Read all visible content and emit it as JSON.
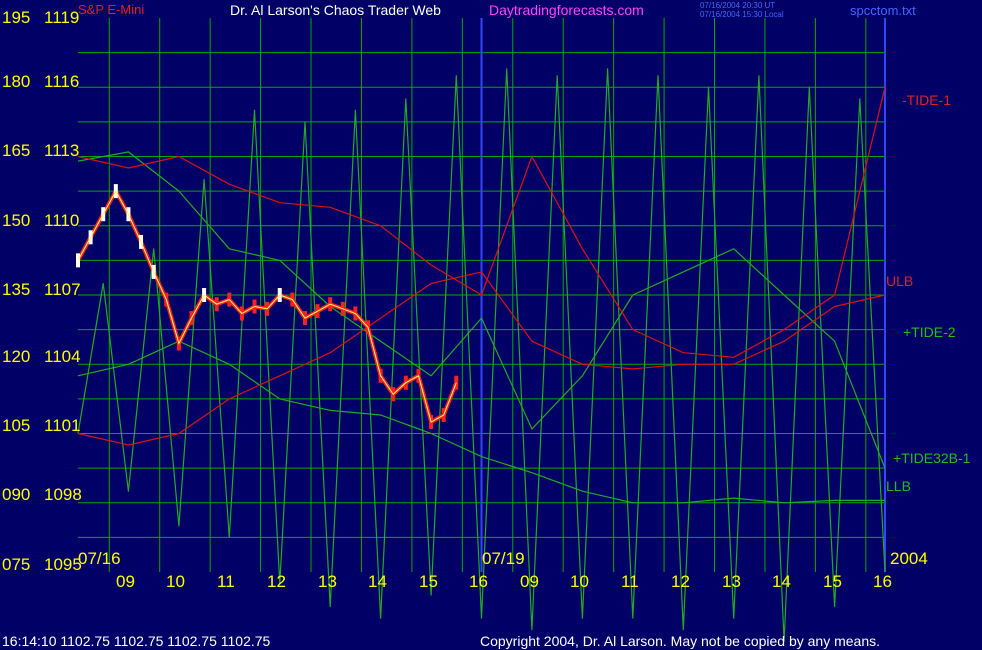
{
  "header": {
    "instrument": "S&P E-Mini",
    "title": "Dr. Al Larson's Chaos Trader Web",
    "site": "Daytradingforecasts.com",
    "time_line1": "07/16/2004 20:30 UT",
    "time_line2": "07/16/2004 15:30 Local",
    "filename": "spcctom.txt"
  },
  "footer": {
    "quote": "16:14:10  1102.75 1102.75 1102.75 1102.75",
    "copyright": "Copyright 2004, Dr. Al Larson. May not be copied by any means."
  },
  "colors": {
    "background": "#000066",
    "grid": "#00aa00",
    "divider": "#3344ff",
    "red_curve": "#dd1111",
    "green_curve": "#22aa22",
    "text_yellow": "#ffff00",
    "text_magenta": "#ff44ff",
    "text_blue": "#4466ff"
  },
  "chart_data": {
    "type": "line",
    "title": "Dr. Al Larson's Chaos Trader Web",
    "y_axis_left_labels": [
      "195",
      "180",
      "165",
      "150",
      "135",
      "120",
      "105",
      "090",
      "075"
    ],
    "y_axis_price_labels": [
      "1119",
      "1116",
      "1113",
      "1110",
      "1107",
      "1104",
      "1101",
      "1098",
      "1095"
    ],
    "date_labels": [
      "07/16",
      "07/19",
      "2004"
    ],
    "x_tick_labels": [
      "09",
      "10",
      "11",
      "12",
      "13",
      "14",
      "15",
      "16",
      "09",
      "10",
      "11",
      "12",
      "13",
      "14",
      "15",
      "16"
    ],
    "series_labels": {
      "tide1": "-TIDE-1",
      "ulb": "ULB",
      "tide2": "+TIDE-2",
      "tide32b": "+TIDE32B-1",
      "llb": "LLB"
    },
    "price_range": [
      1095,
      1119
    ],
    "price_bars": {
      "x": [
        0.0,
        0.25,
        0.5,
        0.75,
        1.0,
        1.25,
        1.5,
        1.75,
        2.0,
        2.25,
        2.5,
        2.75,
        3.0,
        3.25,
        3.5,
        3.75,
        4.0,
        4.25,
        4.5,
        4.75,
        5.0,
        5.25,
        5.5,
        5.75,
        6.0,
        6.25,
        6.5,
        6.75,
        7.0,
        7.25,
        7.5
      ],
      "close": [
        1108.5,
        1109.5,
        1110.5,
        1111.5,
        1110.5,
        1109.3,
        1108.0,
        1106.8,
        1104.9,
        1106.0,
        1107.0,
        1106.6,
        1106.8,
        1106.2,
        1106.5,
        1106.4,
        1107.0,
        1106.8,
        1106.0,
        1106.3,
        1106.6,
        1106.4,
        1106.2,
        1105.6,
        1103.5,
        1102.7,
        1103.2,
        1103.5,
        1101.5,
        1101.8,
        1103.2
      ]
    },
    "tide1": {
      "x": [
        0.0,
        1.0,
        2.0,
        3.0,
        4.0,
        5.0,
        6.0,
        7.0,
        8.0,
        9.0,
        10.0,
        11.0,
        12.0,
        13.0,
        14.0,
        15.0,
        16.0
      ],
      "y": [
        1113.0,
        1112.5,
        1113.0,
        1111.8,
        1111.0,
        1110.8,
        1110.0,
        1108.3,
        1107.0,
        1113.0,
        1109.0,
        1105.5,
        1104.5,
        1104.3,
        1105.5,
        1107.0,
        1116.0
      ]
    },
    "ulb": {
      "x": [
        0.0,
        1.0,
        2.0,
        3.0,
        4.0,
        5.0,
        6.0,
        7.0,
        8.0,
        9.0,
        10.0,
        11.0,
        12.0,
        13.0,
        14.0,
        15.0,
        16.0
      ],
      "y": [
        1101.0,
        1100.5,
        1101.0,
        1102.5,
        1103.5,
        1104.5,
        1106.0,
        1107.5,
        1108.0,
        1105.0,
        1104.0,
        1103.8,
        1104.0,
        1104.0,
        1105.0,
        1106.5,
        1107.0
      ]
    },
    "llb": {
      "x": [
        0.0,
        1.0,
        2.0,
        3.0,
        4.0,
        5.0,
        6.0,
        7.0,
        8.0,
        9.0,
        10.0,
        11.0,
        12.0,
        13.0,
        14.0,
        15.0,
        16.0
      ],
      "y": [
        1103.5,
        1104.0,
        1105.0,
        1104.0,
        1102.5,
        1102.0,
        1101.8,
        1101.0,
        1100.0,
        1099.3,
        1098.5,
        1098.0,
        1098.0,
        1098.2,
        1098.0,
        1098.1,
        1098.1
      ]
    },
    "tide2": {
      "x": [
        0.0,
        1.0,
        2.0,
        3.0,
        4.0,
        5.0,
        6.0,
        7.0,
        8.0,
        9.0,
        10.0,
        11.0,
        12.0,
        13.0,
        14.0,
        15.0,
        16.0
      ],
      "y": [
        1112.8,
        1113.2,
        1111.5,
        1109.0,
        1108.5,
        1106.5,
        1105.0,
        1103.5,
        1106.0,
        1101.2,
        1103.5,
        1107.0,
        1108.0,
        1109.0,
        1107.0,
        1105.0,
        1099.5
      ]
    },
    "tide32b": {
      "x": [
        0.0,
        0.5,
        1.0,
        1.5,
        2.0,
        2.5,
        3.0,
        3.5,
        4.0,
        4.5,
        5.0,
        5.5,
        6.0,
        6.5,
        7.0,
        7.5,
        8.0,
        8.5,
        9.0,
        9.5,
        10.0,
        10.5,
        11.0,
        11.5,
        12.0,
        12.5,
        13.0,
        13.5,
        14.0,
        14.5,
        15.0,
        15.5,
        16.0
      ],
      "y": [
        1101.0,
        1107.5,
        1098.5,
        1109.0,
        1097.0,
        1112.0,
        1096.5,
        1115.0,
        1094.5,
        1114.5,
        1093.5,
        1115.0,
        1093.0,
        1115.5,
        1094.0,
        1116.5,
        1093.0,
        1116.8,
        1092.5,
        1116.5,
        1093.0,
        1116.8,
        1093.0,
        1116.5,
        1092.5,
        1116.0,
        1093.0,
        1116.5,
        1092.0,
        1116.0,
        1093.5,
        1115.5,
        1095.0
      ]
    },
    "grid": true
  }
}
